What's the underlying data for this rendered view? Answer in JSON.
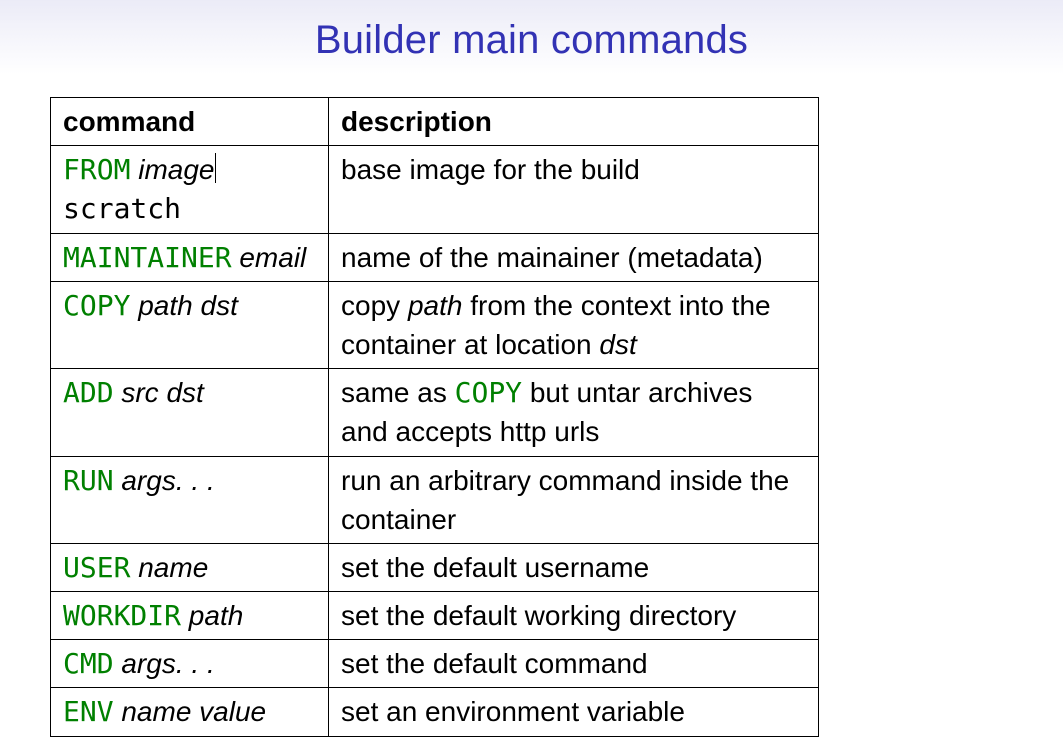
{
  "title": "Builder main commands",
  "headers": {
    "cmd": "command",
    "desc": "description"
  },
  "rows": [
    {
      "cmd": {
        "kw": "FROM",
        "a1": "image",
        "sep": true,
        "a2_plain": "scratch"
      },
      "desc": [
        {
          "t": "base image for the build"
        }
      ]
    },
    {
      "cmd": {
        "kw": "MAINTAINER",
        "a1": "email"
      },
      "desc": [
        {
          "t": "name of the mainainer (metadata)"
        }
      ]
    },
    {
      "cmd": {
        "kw": "COPY",
        "a1": "path dst"
      },
      "desc": [
        {
          "t": "copy "
        },
        {
          "arg": "path"
        },
        {
          "t": " from the context into the container at location "
        },
        {
          "arg": "dst"
        }
      ]
    },
    {
      "cmd": {
        "kw": "ADD",
        "a1": "src dst"
      },
      "desc": [
        {
          "t": "same as "
        },
        {
          "tt": "COPY"
        },
        {
          "t": " but untar archives and accepts http urls"
        }
      ]
    },
    {
      "cmd": {
        "kw": "RUN",
        "a1": "args. . ."
      },
      "desc": [
        {
          "t": "run an arbitrary command inside the container"
        }
      ]
    },
    {
      "cmd": {
        "kw": "USER",
        "a1": "name"
      },
      "desc": [
        {
          "t": "set the default username"
        }
      ]
    },
    {
      "cmd": {
        "kw": "WORKDIR",
        "a1": "path"
      },
      "desc": [
        {
          "t": "set the default working directory"
        }
      ]
    },
    {
      "cmd": {
        "kw": "CMD",
        "a1": "args. . ."
      },
      "desc": [
        {
          "t": "set the default command"
        }
      ]
    },
    {
      "cmd": {
        "kw": "ENV",
        "a1": "name value"
      },
      "desc": [
        {
          "t": "set an environment variable"
        }
      ]
    }
  ]
}
